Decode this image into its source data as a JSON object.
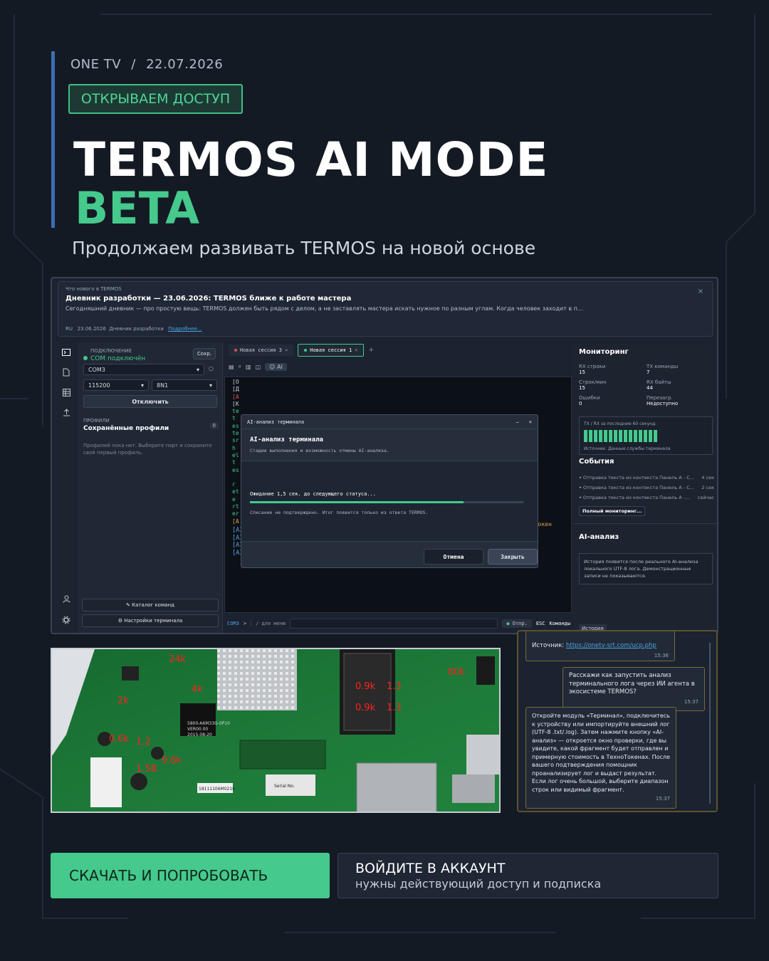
{
  "header": {
    "brand": "ONE TV",
    "separator": "/",
    "date": "22.07.2026",
    "badge": "ОТКРЫВАЕМ ДОСТУП",
    "title": "TERMOS AI MODE",
    "title_accent": "BETA",
    "subtitle": "Продолжаем развивать TERMOS на новой основе"
  },
  "colors": {
    "accent": "#45c98c",
    "background": "#141a24",
    "link": "#4aa3e0",
    "warning": "#e0a040",
    "error": "#e05050"
  },
  "news": {
    "label": "Что нового в TERMOS",
    "title": "Дневник разработки — 23.06.2026: TERMOS ближе к работе мастера",
    "body": "Сегодняшний дневник — про простую вещь: TERMOS должен быть рядом с делом, а не заставлять мастера искать нужное по разным углам. Когда человек заходит в п...",
    "lang": "RU",
    "date": "23.06.2026",
    "section": "Дневник разработки",
    "more": "Подробнее...",
    "close": "×"
  },
  "sidebar_icons": [
    "terminal-icon",
    "document-icon",
    "grid-icon",
    "upload-icon",
    "user-icon",
    "gear-icon"
  ],
  "connection": {
    "label": "ПОДКЛЮЧЕНИЕ",
    "status": "COM подключён",
    "save": "Сохр.",
    "port": "COM3",
    "baud": "115200",
    "format": "8N1",
    "disconnect": "Отключить"
  },
  "profiles": {
    "label": "ПРОФИЛИ",
    "title": "Сохранённые профили",
    "count": "0",
    "empty": "Профилей пока нет. Выберите порт и сохраните свой первый профиль."
  },
  "left_buttons": {
    "catalog": "Каталог команд",
    "settings": "Настройки терминала"
  },
  "tabs": [
    {
      "label": "Новая сессия 3",
      "close": "×",
      "active": false
    },
    {
      "label": "Новая сессия 1",
      "close": "×",
      "active": true
    }
  ],
  "add_tab": "+",
  "toolbar": {
    "ai": "AI"
  },
  "terminal": {
    "side_chars": [
      "[O",
      "[Д",
      "[A",
      "[К",
      "te",
      "t",
      "es",
      "te",
      "sr",
      "h",
      "el",
      "t",
      "es",
      "",
      "r",
      "et",
      "e",
      "rt",
      "er",
      "[A"
    ],
    "token_text": "оТокен",
    "lines": [
      "[AI] Запуск AI...",
      "[AI] Job 277 создан, загружаем лог...",
      "[AI] Отправка лога...",
      "[AI] Ожидание 1,5 сек. до следующего статуса..."
    ]
  },
  "modal": {
    "window_title": "AI-анализ терминала",
    "minimize": "–",
    "close": "×",
    "heading": "AI-анализ терминала",
    "subheading": "Стадии выполнения и возможность отмены AI-анализа.",
    "waiting": "Ожидание 1,5 сек. до следующего статуса...",
    "progress": 0.78,
    "note": "Списание не подтверждено. Итог появится только из ответа TERMOS.",
    "cancel": "Отмена",
    "close_btn": "Закрыть"
  },
  "command_line": {
    "port": "COM3",
    "arrow": ">",
    "hint": "/ для меню",
    "send": "Отпр.",
    "esc": "ESC",
    "commands": "Команды"
  },
  "monitoring": {
    "title": "Мониторинг",
    "metrics": [
      {
        "k": "RX строки",
        "v": "15"
      },
      {
        "k": "TX команды",
        "v": "7"
      },
      {
        "k": "Строк/мин",
        "v": "15"
      },
      {
        "k": "RX байты",
        "v": "44"
      },
      {
        "k": "Ошибки",
        "v": "0"
      },
      {
        "k": "Перезагр.",
        "v": "Недоступно"
      }
    ],
    "chart_label": "TX / RX за последние 60 секунд",
    "chart_source": "Источник: Данные службы терминала"
  },
  "events": {
    "title": "События",
    "items": [
      {
        "text": "Отправка текста из контекста Панель А - С...",
        "time": "4 сек"
      },
      {
        "text": "Отправка текста из контекста Панель А - С...",
        "time": "2 сек"
      },
      {
        "text": "Отправка текста из контекста Панель А -...",
        "time": "сейчас"
      }
    ],
    "full": "Полный мониторинг..."
  },
  "ai_analysis": {
    "title": "AI-анализ",
    "text": "История появится после реального AI-анализа локального UTF-8 лога. Демонстрационные записи не показываются.",
    "history": "История"
  },
  "photo": {
    "labels": [
      "24k",
      "4k",
      "2k",
      "1.2",
      "0.6k",
      "1.5B",
      "9.6k",
      "0.9k",
      "0.9k",
      "1.3",
      "1.3",
      "80k"
    ],
    "chip_text": "5800-A6M33G-0P10\nVER00.00\n2015-08-20",
    "sticker": "18111106M0216",
    "serial": "Serial No."
  },
  "chat": {
    "source_label": "Источник:",
    "source_link": "https://onetv-srt.com/ucp.php",
    "source_time": "15:36",
    "user_msg": "Расскажи как запустить анализ терминального лога через ИИ агента в экосистеме TERMOS?",
    "user_time": "15:37",
    "bot_msg": "Откройте модуль «Терминал», подключитесь к устройству или импортируйте внешний лог (UTF-8 .txt/.log). Затем нажмите кнопку «AI-анализ» — откроется окно проверки, где вы увидите, какой фрагмент будет отправлен и примерную стоимость в ТехноТокенах. После вашего подтверждения помощник проанализирует лог и выдаст результат. Если лог очень большой, выберите диапазон строк или видимый фрагмент.",
    "bot_time": "15:37"
  },
  "cta": {
    "download": "СКАЧАТЬ И ПОПРОБОВАТЬ",
    "login": "ВОЙДИТЕ В АККАУНТ",
    "login_sub": "нужны действующий доступ и подписка"
  }
}
